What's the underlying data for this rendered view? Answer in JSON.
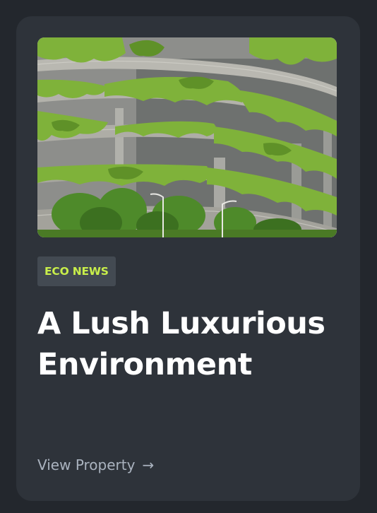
{
  "card": {
    "image_alt": "Building terraces covered with hanging greenery",
    "badge": "ECO NEWS",
    "title": "A Lush Luxurious Environment",
    "cta_label": "View Property",
    "cta_icon": "arrow-right-icon"
  },
  "colors": {
    "page_background": "#23272d",
    "card_background": "#2e333a",
    "badge_background": "#434a52",
    "badge_text": "#c8ee4a",
    "title_text": "#ffffff",
    "cta_text": "#aab3bf"
  }
}
